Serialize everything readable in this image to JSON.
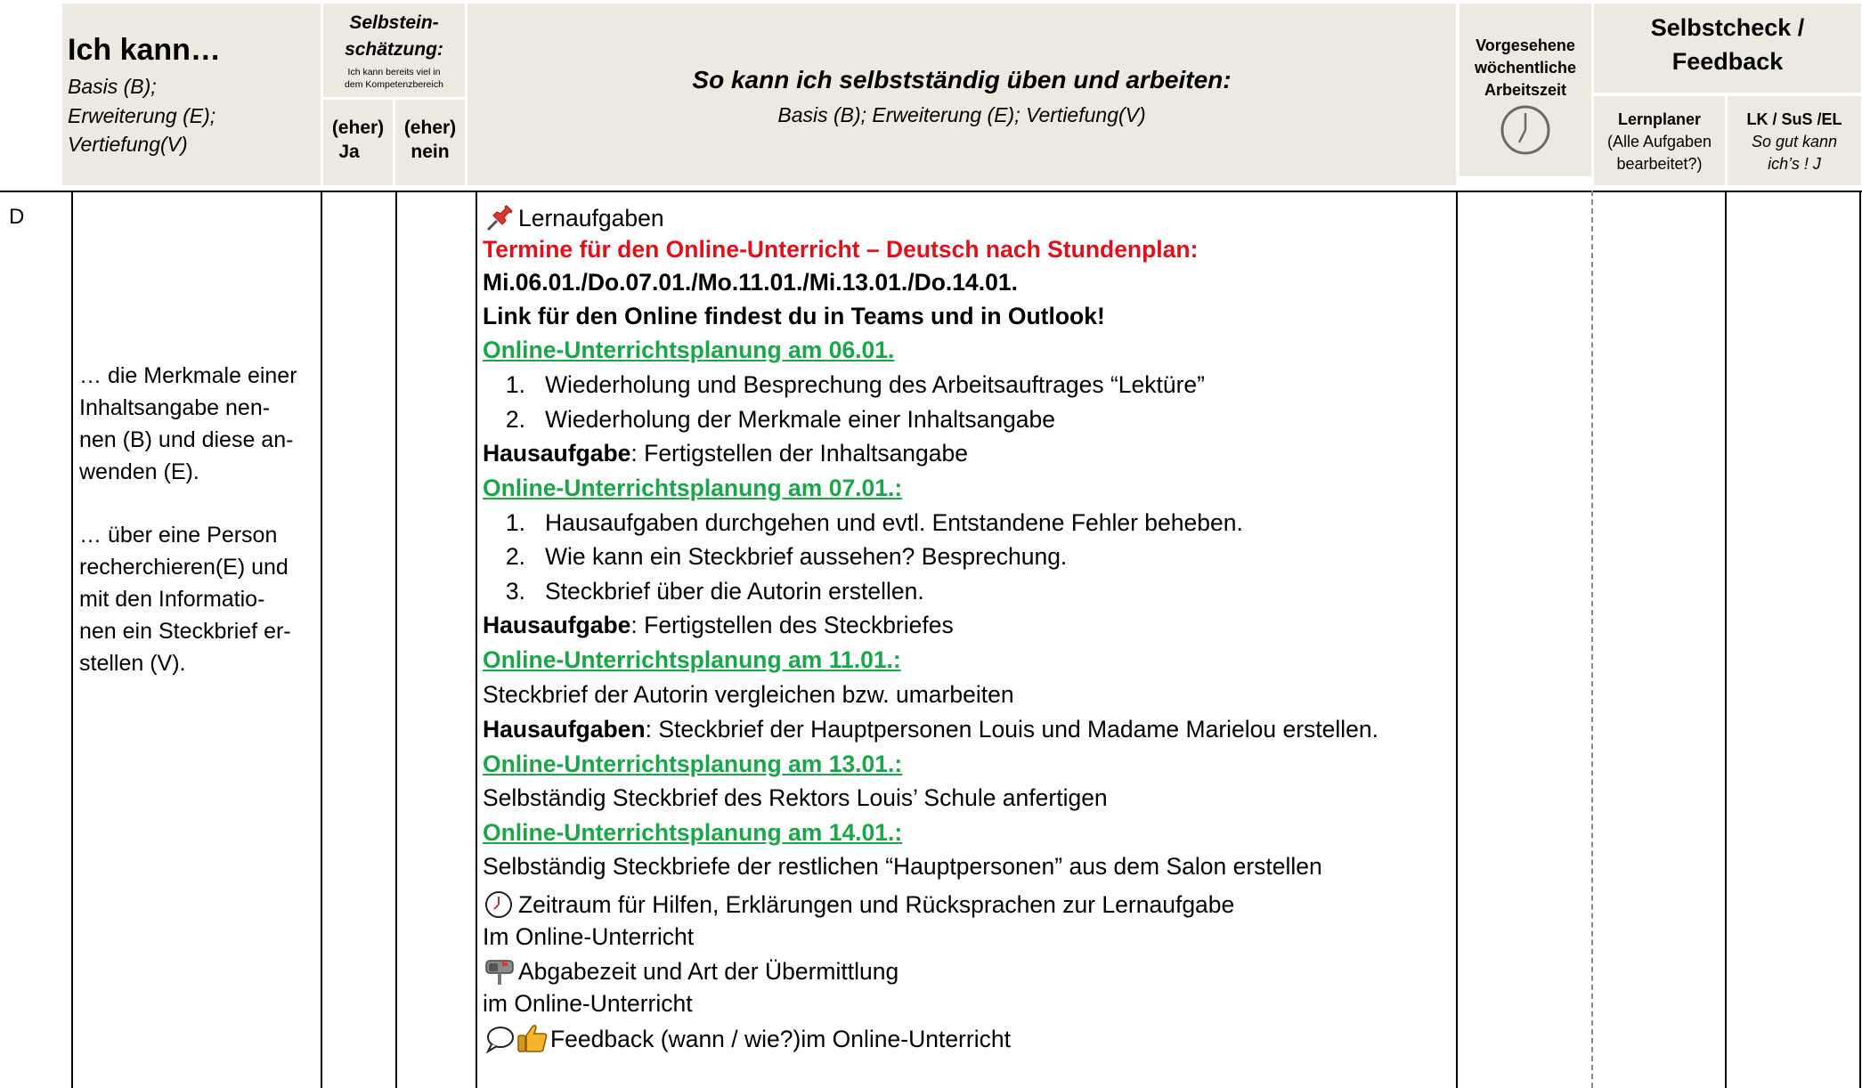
{
  "header": {
    "col1": {
      "title": "Ich kann…",
      "subtitle_lines": [
        "Basis (B);",
        "Erweiterung (E);",
        "Vertiefung(V)"
      ]
    },
    "col2": {
      "title_lines": [
        "Selbstein-",
        "schätzung:"
      ],
      "note_lines": [
        "Ich kann bereits viel in",
        "dem Kompetenzbereich"
      ],
      "yes_lines": [
        "(eher)",
        "Ja"
      ],
      "no_lines": [
        "(eher)",
        "nein"
      ]
    },
    "col3": {
      "title": "So kann ich selbstständig üben und arbeiten:",
      "subtitle": "Basis (B); Erweiterung (E); Vertiefung(V)"
    },
    "col4": {
      "title_lines": [
        "Vorgesehene",
        "wöchentliche",
        "Arbeitszeit"
      ],
      "icon": "clock-icon"
    },
    "col5": {
      "title_lines": [
        "Selbstcheck /",
        "Feedback"
      ],
      "lernplaner_title": "Lernplaner",
      "lernplaner_note_lines": [
        "(Alle Aufgaben",
        "bearbeitet?)"
      ],
      "lk_title": "LK / SuS /EL",
      "lk_note_lines": [
        "So gut kann",
        "ich’s ! J"
      ]
    }
  },
  "row": {
    "subject": "D",
    "competence_lines": [
      "… die Merkmale einer",
      "Inhaltsangabe nen-",
      "nen (B) und diese an-",
      "wenden (E).",
      "",
      "… über eine Person",
      "recherchieren(E) und",
      "mit den Informatio-",
      "nen ein Steckbrief er-",
      "stellen (V)."
    ],
    "tasks": {
      "lernaufgaben": "Lernaufgaben",
      "termine": "Termine für den Online-Unterricht – Deutsch nach Stundenplan:",
      "dates": "Mi.06.01./Do.07.01./Mo.11.01./Mi.13.01./Do.14.01.",
      "link": "Link für den Online findest du in Teams und in Outlook!",
      "plan1_heading": "Online-Unterrichtsplanung am 06.01.",
      "plan1_items": [
        {
          "n": "1.",
          "text": "Wiederholung und Besprechung des Arbeitsauftrages “Lektüre”"
        },
        {
          "n": "2.",
          "text": "Wiederholung der Merkmale einer Inhaltsangabe"
        }
      ],
      "hw1_label": "Hausaufgabe",
      "hw1_text": ": Fertigstellen der Inhaltsangabe",
      "plan2_heading": "Online-Unterrichtsplanung am 07.01.:",
      "plan2_items": [
        {
          "n": "1.",
          "text": "Hausaufgaben durchgehen und evtl. Entstandene Fehler beheben."
        },
        {
          "n": "2.",
          "text": "Wie kann ein Steckbrief aussehen? Besprechung."
        },
        {
          "n": "3.",
          "text": "Steckbrief über die Autorin erstellen."
        }
      ],
      "hw2_label": "Hausaufgabe",
      "hw2_text": ": Fertigstellen des Steckbriefes",
      "plan3_heading": "Online-Unterrichtsplanung am 11.01.:",
      "plan3_text": "Steckbrief der Autorin vergleichen bzw. umarbeiten",
      "hw3_label": "Hausaufgaben",
      "hw3_text": ": Steckbrief der Hauptpersonen Louis und Madame Marielou erstellen.",
      "plan4_heading": "Online-Unterrichtsplanung am 13.01.:",
      "plan4_text": "Selbständig Steckbrief des Rektors  Louis’ Schule anfertigen",
      "plan5_heading": "Online-Unterrichtsplanung am 14.01.:",
      "plan5_text": "Selbständig Steckbriefe der restlichen “Hauptpersonen” aus dem Salon erstellen",
      "zeitraum": "Zeitraum für Hilfen, Erklärungen und Rücksprachen zur Lernaufgabe",
      "zeitraum_value": "Im Online-Unterricht",
      "abgabe": "Abgabezeit und Art der Übermittlung",
      "abgabe_value": "im Online-Unterricht",
      "feedback": "Feedback (wann / wie?)im Online-Unterricht"
    },
    "icons": [
      "pin-icon",
      "clock-small-icon",
      "mailbox-icon",
      "speech-bubble-icon",
      "thumbs-up-icon"
    ]
  }
}
